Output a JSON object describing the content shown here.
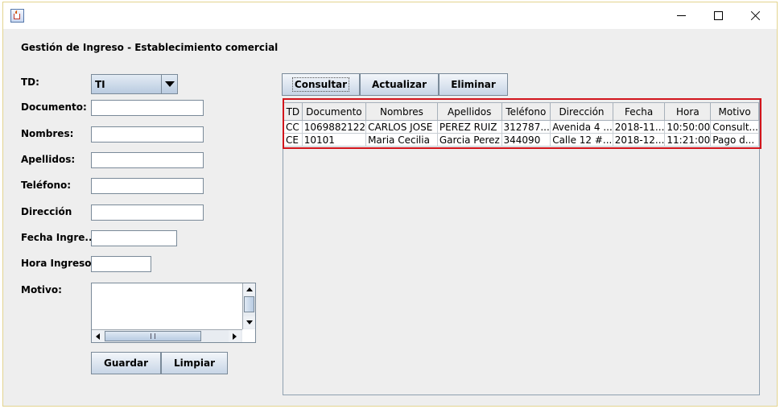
{
  "window": {
    "controls": {
      "minimize_icon": "minimize-icon",
      "maximize_icon": "maximize-icon",
      "close_icon": "close-icon"
    }
  },
  "form": {
    "title": "Gestión de Ingreso - Establecimiento comercial",
    "labels": {
      "td": "TD:",
      "documento": "Documento:",
      "nombres": "Nombres:",
      "apellidos": "Apellidos:",
      "telefono": "Teléfono:",
      "direccion": "Dirección",
      "fecha": "Fecha Ingre...",
      "hora": "Hora Ingreso:",
      "motivo": "Motivo:"
    },
    "td_value": "TI",
    "fields": {
      "documento": "",
      "nombres": "",
      "apellidos": "",
      "telefono": "",
      "direccion": "",
      "fecha": "",
      "hora": "",
      "motivo": ""
    },
    "buttons": {
      "guardar": "Guardar",
      "limpiar": "Limpiar"
    }
  },
  "actions": {
    "consultar": "Consultar",
    "actualizar": "Actualizar",
    "eliminar": "Eliminar"
  },
  "table": {
    "columns": [
      "TD",
      "Documento",
      "Nombres",
      "Apellidos",
      "Teléfono",
      "Dirección",
      "Fecha",
      "Hora",
      "Motivo"
    ],
    "rows": [
      [
        "CC",
        "1069882122",
        "CARLOS JOSE",
        "PEREZ RUIZ",
        "312787...",
        "Avenida 4 ...",
        "2018-11...",
        "10:50:00",
        "Consult..."
      ],
      [
        "CE",
        "10101",
        "Maria Cecilia",
        "Garcia Perez",
        "344090",
        "Calle 12 #...",
        "2018-12...",
        "11:21:00",
        "Pago d..."
      ]
    ]
  },
  "colors": {
    "highlight": "#d2151c",
    "button_gradient_top": "#f3f6fa",
    "button_gradient_bottom": "#c7d5e6"
  }
}
